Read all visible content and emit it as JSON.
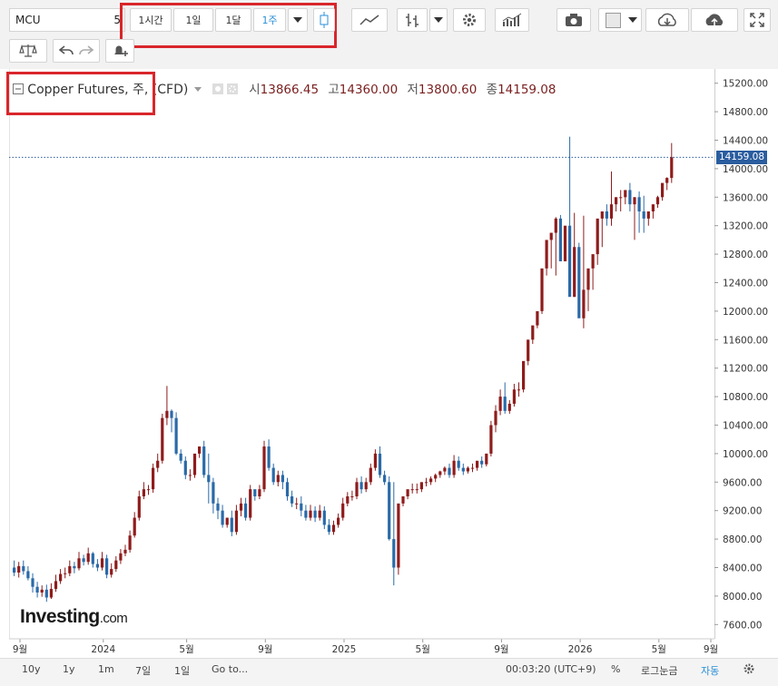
{
  "toolbar": {
    "symbol": "MCU",
    "symbol_extra": "5",
    "intervals": [
      "1시간",
      "1일",
      "1달",
      "1주"
    ],
    "active_interval": "1주"
  },
  "legend": {
    "title": "Copper Futures, 주, (CFD)",
    "open_label": "시",
    "open": "13866.45",
    "high_label": "고",
    "high": "14360.00",
    "low_label": "저",
    "low": "13800.60",
    "close_label": "종",
    "close": "14159.08"
  },
  "last_price_label": "14159.08",
  "price_ticks": [
    "15200.00",
    "14800.00",
    "14400.00",
    "14000.00",
    "13600.00",
    "13200.00",
    "12800.00",
    "12400.00",
    "12000.00",
    "11600.00",
    "11200.00",
    "10800.00",
    "10400.00",
    "10000.00",
    "9600.00",
    "9200.00",
    "8800.00",
    "8400.00",
    "8000.00",
    "7600.00"
  ],
  "time_ticks": [
    "9월",
    "2024",
    "5월",
    "9월",
    "2025",
    "5월",
    "9월",
    "2026",
    "5월",
    "9월"
  ],
  "bottom_bar": {
    "ranges": [
      "10y",
      "1y",
      "1m",
      "7일",
      "1일"
    ],
    "goto": "Go to...",
    "clock": "00:03:20 (UTC+9)",
    "percent": "%",
    "log": "로그눈금",
    "auto": "자동"
  },
  "brand": {
    "name": "Investing",
    "suffix": ".com"
  },
  "colors": {
    "up": "#8e1c1c",
    "down": "#2a6aa8",
    "price_line": "#2a5d9f",
    "highlight": "#d9262b"
  },
  "chart_data": {
    "type": "candlestick",
    "title": "Copper Futures, 주, (CFD)",
    "ylim": [
      7400,
      15400
    ],
    "series": [
      {
        "open": [
          8400,
          8330,
          8420,
          8350,
          8250,
          8130,
          8050,
          8090,
          7980,
          8100,
          8210,
          8310,
          8320,
          8420,
          8390,
          8530,
          8480,
          8600,
          8450,
          8400,
          8530,
          8300,
          8380,
          8500,
          8600,
          8650,
          8850,
          9100,
          9400,
          9500,
          9500,
          9800,
          9900,
          10500,
          10600,
          10500,
          10000,
          9900,
          9700,
          9700,
          10000,
          10100,
          9700,
          9600,
          9300,
          9200,
          9000,
          9100,
          8900,
          9200,
          9300,
          9100,
          9500,
          9400,
          9500,
          10100,
          9800,
          9600,
          9700,
          9600,
          9400,
          9300,
          9300,
          9200,
          9100,
          9200,
          9100,
          9200,
          9000,
          8900,
          9000,
          9100,
          9300,
          9400,
          9400,
          9600,
          9500,
          9600,
          9800,
          10000,
          9700,
          9600,
          8800,
          8400,
          9300,
          9400,
          9500,
          9500,
          9500,
          9600,
          9600,
          9650,
          9700,
          9750,
          9800,
          9700,
          9900,
          9800,
          9750,
          9800,
          9800,
          9900,
          9850,
          10000,
          10400,
          10600,
          10800,
          10600,
          10700,
          10900,
          10900,
          11300,
          11600,
          11800,
          12000,
          12600,
          13000,
          13100,
          13300,
          12700,
          13200,
          12200,
          12900,
          11900,
          12300,
          12600,
          12800,
          13300,
          13400,
          13300,
          13500,
          13600,
          13600,
          13700,
          13500,
          13600,
          13400,
          13300,
          13400,
          13500,
          13600,
          13800,
          13870
        ],
        "close": [
          8330,
          8420,
          8350,
          8250,
          8130,
          8050,
          8090,
          7980,
          8100,
          8210,
          8310,
          8320,
          8420,
          8390,
          8530,
          8480,
          8600,
          8450,
          8400,
          8530,
          8300,
          8380,
          8500,
          8600,
          8650,
          8850,
          9100,
          9400,
          9500,
          9500,
          9800,
          9900,
          10500,
          10600,
          10500,
          10000,
          9900,
          9700,
          9700,
          10000,
          10100,
          9700,
          9600,
          9300,
          9200,
          9000,
          9100,
          8900,
          9200,
          9300,
          9100,
          9500,
          9400,
          9500,
          10100,
          9800,
          9600,
          9700,
          9600,
          9400,
          9300,
          9300,
          9200,
          9100,
          9200,
          9100,
          9200,
          9000,
          8900,
          9000,
          9100,
          9300,
          9400,
          9400,
          9600,
          9500,
          9600,
          9800,
          10000,
          9700,
          9600,
          8800,
          8400,
          9300,
          9400,
          9500,
          9500,
          9500,
          9600,
          9600,
          9650,
          9700,
          9750,
          9800,
          9700,
          9900,
          9800,
          9750,
          9800,
          9800,
          9900,
          9850,
          10000,
          10400,
          10600,
          10800,
          10600,
          10700,
          10900,
          10900,
          11300,
          11600,
          11800,
          12000,
          12600,
          13000,
          13100,
          13300,
          12700,
          13200,
          12200,
          12900,
          11900,
          12300,
          12600,
          12800,
          13300,
          13400,
          13300,
          13500,
          13600,
          13600,
          13700,
          13500,
          13600,
          13400,
          13300,
          13400,
          13500,
          13600,
          13800,
          13870,
          14160
        ],
        "high": [
          8500,
          8480,
          8500,
          8420,
          8320,
          8200,
          8150,
          8160,
          8180,
          8300,
          8380,
          8400,
          8500,
          8480,
          8620,
          8580,
          8680,
          8620,
          8520,
          8620,
          8580,
          8460,
          8560,
          8660,
          8720,
          8920,
          9180,
          9480,
          9600,
          9560,
          9860,
          10000,
          10560,
          10950,
          10620,
          10580,
          10060,
          9960,
          9780,
          9760,
          10080,
          10180,
          10000,
          9660,
          9380,
          9280,
          9100,
          9200,
          9280,
          9380,
          9380,
          9560,
          9480,
          9560,
          10180,
          10200,
          9860,
          9760,
          9760,
          9660,
          9480,
          9380,
          9400,
          9280,
          9280,
          9260,
          9280,
          9260,
          9080,
          9060,
          9160,
          9380,
          9460,
          9480,
          9660,
          9680,
          9660,
          9860,
          10060,
          10100,
          9760,
          9680,
          9600,
          8450,
          9400,
          9460,
          9580,
          9580,
          9580,
          9660,
          9680,
          9720,
          9760,
          9820,
          9860,
          9980,
          9960,
          9860,
          9820,
          9860,
          9880,
          9960,
          10000,
          10460,
          10680,
          10900,
          11000,
          10750,
          10980,
          11000,
          11200,
          11380,
          11700,
          12000,
          12220,
          12760,
          13100,
          13320,
          13350,
          13060,
          14450,
          13380,
          12960,
          13340,
          12400,
          12700,
          13020,
          13400,
          13500,
          13960,
          13600,
          13700,
          13700,
          13800,
          13600,
          13680,
          13620,
          13400,
          13480,
          13620,
          13720,
          13880,
          14360
        ],
        "low": [
          8280,
          8260,
          8300,
          8220,
          8050,
          7980,
          7990,
          7920,
          7960,
          8060,
          8170,
          8250,
          8280,
          8320,
          8360,
          8430,
          8440,
          8400,
          8350,
          8360,
          8250,
          8260,
          8340,
          8450,
          8560,
          8610,
          8820,
          9060,
          9360,
          9420,
          9450,
          9740,
          9860,
          10400,
          10300,
          9980,
          9860,
          9640,
          9620,
          9660,
          9940,
          9660,
          9300,
          9160,
          9080,
          8960,
          8960,
          8840,
          8860,
          9120,
          9060,
          9060,
          9340,
          9360,
          9460,
          9760,
          9560,
          9540,
          9500,
          9340,
          9250,
          9220,
          9120,
          9060,
          9060,
          9040,
          9060,
          8940,
          8860,
          8860,
          8960,
          9060,
          9260,
          9340,
          9360,
          9440,
          9460,
          9560,
          9760,
          9660,
          9560,
          8780,
          8150,
          8300,
          9260,
          9360,
          9440,
          9440,
          9460,
          9540,
          9560,
          9600,
          9660,
          9700,
          9660,
          9660,
          9760,
          9700,
          9720,
          9740,
          9760,
          9800,
          9820,
          9960,
          10300,
          10540,
          10560,
          10560,
          10660,
          10800,
          10860,
          11240,
          11540,
          11760,
          11960,
          12500,
          12600,
          12500,
          12700,
          12700,
          12600,
          12200,
          12000,
          11760,
          12000,
          12300,
          12650,
          12900,
          13200,
          13200,
          13400,
          13400,
          13500,
          13400,
          13000,
          13100,
          13100,
          13200,
          13300,
          13450,
          13550,
          13700,
          13800
        ]
      }
    ]
  }
}
